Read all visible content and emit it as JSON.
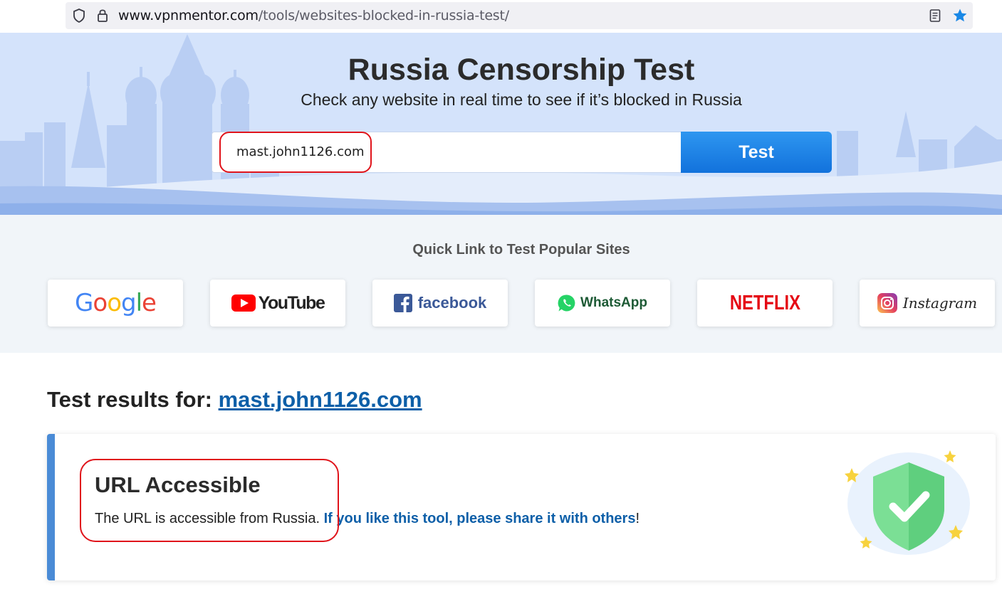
{
  "browser": {
    "url_domain": "www.vpnmentor.com",
    "url_path": "/tools/websites-blocked-in-russia-test/"
  },
  "hero": {
    "title": "Russia Censorship Test",
    "subtitle": "Check any website in real time to see if it’s blocked in Russia",
    "input_value": "mast.john1126.com",
    "button_label": "Test"
  },
  "quick_links": {
    "title": "Quick Link to Test Popular Sites",
    "items": [
      {
        "name": "google",
        "label": "Google"
      },
      {
        "name": "youtube",
        "label": "YouTube"
      },
      {
        "name": "facebook",
        "label": "facebook"
      },
      {
        "name": "whatsapp",
        "label": "WhatsApp"
      },
      {
        "name": "netflix",
        "label": "NETFLIX"
      },
      {
        "name": "instagram",
        "label": "Instagram"
      }
    ]
  },
  "results": {
    "prefix": "Test results for: ",
    "url": "mast.john1126.com",
    "status_title": "URL Accessible",
    "status_desc": "The URL is accessible from Russia. ",
    "share_text": "If you like this tool, please share it with others",
    "share_suffix": "!"
  },
  "colors": {
    "accent": "#1a7fe4",
    "link": "#0d5fa8",
    "highlight": "#e0141b",
    "success": "#6dd58c"
  },
  "icons": [
    "shield-icon",
    "lock-icon",
    "reader-mode-icon",
    "bookmark-star-icon",
    "check-shield-icon"
  ]
}
